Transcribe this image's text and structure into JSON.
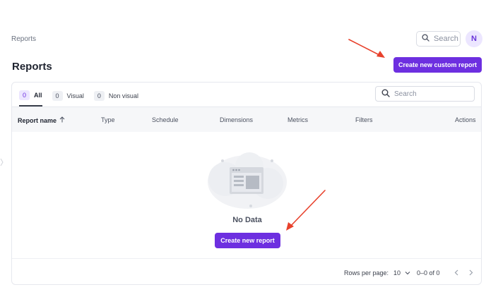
{
  "breadcrumb": {
    "current": "Reports"
  },
  "header": {
    "search_placeholder": "Search",
    "avatar_initial": "N"
  },
  "page": {
    "title": "Reports",
    "create_custom_label": "Create new custom report"
  },
  "tabs": [
    {
      "count": "0",
      "label": "All",
      "active": true
    },
    {
      "count": "0",
      "label": "Visual",
      "active": false
    },
    {
      "count": "0",
      "label": "Non visual",
      "active": false
    }
  ],
  "card": {
    "search_placeholder": "Search"
  },
  "table": {
    "columns": [
      "Report name",
      "Type",
      "Schedule",
      "Dimensions",
      "Metrics",
      "Filters",
      "Actions"
    ]
  },
  "empty_state": {
    "title": "No Data",
    "create_label": "Create new report"
  },
  "footer": {
    "rows_label": "Rows per page:",
    "rows_value": "10",
    "range": "0–0 of 0"
  },
  "colors": {
    "primary": "#6d2fe0",
    "annotation_arrow": "#e8412c"
  },
  "icons": [
    "search-icon",
    "sort-up-icon",
    "chevron-down-icon",
    "chevron-left-icon",
    "chevron-right-icon",
    "empty-report-illustration"
  ]
}
